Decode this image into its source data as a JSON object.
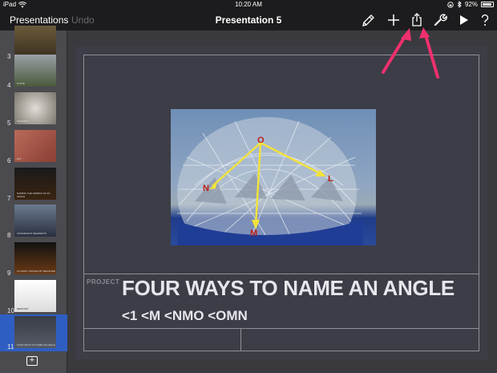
{
  "status_bar": {
    "device": "iPad",
    "time": "10:20 AM",
    "battery": "92%",
    "battery_level": 0.92
  },
  "toolbar": {
    "back_label": "Presentations",
    "undo_label": "Undo",
    "title": "Presentation 5",
    "icons": [
      "format-brush-icon",
      "plus-icon",
      "share-icon",
      "wrench-icon",
      "play-icon",
      "help-icon"
    ]
  },
  "sidebar": {
    "slides": [
      {
        "number": "3",
        "caption": ""
      },
      {
        "number": "4",
        "caption": "PLANE"
      },
      {
        "number": "5",
        "caption": "SEGMENT"
      },
      {
        "number": "6",
        "caption": "RAY"
      },
      {
        "number": "7",
        "caption": "NAMING THE VERTEX OF AN ANGLE"
      },
      {
        "number": "8",
        "caption": "CONGRUENT SEGMENTS"
      },
      {
        "number": "9",
        "caption": "CLASSIFY ANGLES BY MEASURE"
      },
      {
        "number": "10",
        "caption": "MIDPOINT"
      },
      {
        "number": "11",
        "caption": "FOUR WAYS TO NAME AN ANGLE",
        "selected": true
      }
    ],
    "add_slide_label": "+"
  },
  "slide": {
    "project_label": "PROJECT",
    "title": "FOUR WAYS TO NAME AN ANGLE",
    "subtitle": "<1 <M <NMO <OMN",
    "photo_point_labels": [
      "O",
      "N",
      "L",
      "M"
    ]
  },
  "colors": {
    "toolbar_bg": "#1c1c1e",
    "sidebar_bg": "#4a4a4f",
    "selection_blue": "#2f5ec2",
    "slide_bg": "#3c3d46",
    "arrow_pink": "#f0306e",
    "angle_yellow": "#f2e33a"
  }
}
